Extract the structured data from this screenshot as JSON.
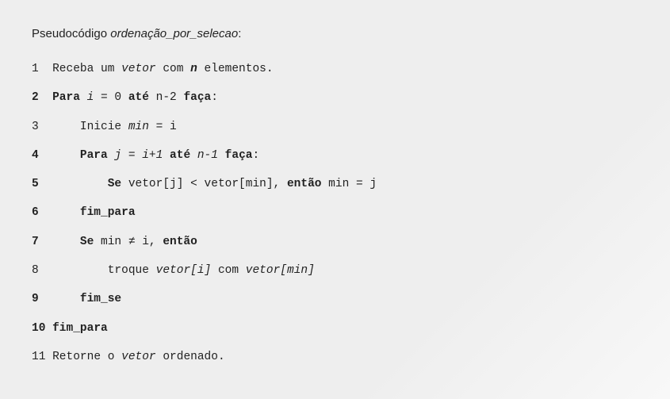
{
  "title": {
    "prefix": "Pseudocódigo ",
    "name": "ordenação_por_selecao",
    "suffix": ":"
  },
  "lines": [
    {
      "num": "1",
      "numBold": false,
      "indent": "",
      "segments": [
        {
          "t": "Receba um ",
          "cls": ""
        },
        {
          "t": "vetor",
          "cls": "i"
        },
        {
          "t": " com ",
          "cls": ""
        },
        {
          "t": "n",
          "cls": "bi"
        },
        {
          "t": " elementos.",
          "cls": ""
        }
      ]
    },
    {
      "num": "2",
      "numBold": true,
      "indent": "",
      "segments": [
        {
          "t": "Para",
          "cls": "b"
        },
        {
          "t": " ",
          "cls": ""
        },
        {
          "t": "i",
          "cls": "i"
        },
        {
          "t": " = 0 ",
          "cls": ""
        },
        {
          "t": "até",
          "cls": "b"
        },
        {
          "t": " n-2 ",
          "cls": ""
        },
        {
          "t": "faça",
          "cls": "b"
        },
        {
          "t": ":",
          "cls": ""
        }
      ]
    },
    {
      "num": "3",
      "numBold": false,
      "indent": "    ",
      "segments": [
        {
          "t": "Inicie ",
          "cls": ""
        },
        {
          "t": "min",
          "cls": "i"
        },
        {
          "t": " = i",
          "cls": ""
        }
      ]
    },
    {
      "num": "4",
      "numBold": true,
      "indent": "    ",
      "segments": [
        {
          "t": "Para",
          "cls": "b"
        },
        {
          "t": " ",
          "cls": ""
        },
        {
          "t": "j",
          "cls": "i"
        },
        {
          "t": " = ",
          "cls": ""
        },
        {
          "t": "i+1",
          "cls": "i"
        },
        {
          "t": " ",
          "cls": ""
        },
        {
          "t": "até",
          "cls": "b"
        },
        {
          "t": " ",
          "cls": ""
        },
        {
          "t": "n-1",
          "cls": "i"
        },
        {
          "t": " ",
          "cls": ""
        },
        {
          "t": "faça",
          "cls": "b"
        },
        {
          "t": ":",
          "cls": ""
        }
      ]
    },
    {
      "num": "5",
      "numBold": true,
      "indent": "        ",
      "segments": [
        {
          "t": "Se",
          "cls": "b"
        },
        {
          "t": " vetor[j] < vetor[min], ",
          "cls": ""
        },
        {
          "t": "então",
          "cls": "b"
        },
        {
          "t": " min = j",
          "cls": ""
        }
      ]
    },
    {
      "num": "6",
      "numBold": true,
      "indent": "    ",
      "segments": [
        {
          "t": "fim_para",
          "cls": "b"
        }
      ]
    },
    {
      "num": "7",
      "numBold": true,
      "indent": "    ",
      "segments": [
        {
          "t": "Se",
          "cls": "b"
        },
        {
          "t": " min ≠ i, ",
          "cls": ""
        },
        {
          "t": "então",
          "cls": "b"
        }
      ]
    },
    {
      "num": "8",
      "numBold": false,
      "indent": "        ",
      "segments": [
        {
          "t": "troque ",
          "cls": ""
        },
        {
          "t": "vetor[i]",
          "cls": "i"
        },
        {
          "t": " com ",
          "cls": ""
        },
        {
          "t": "vetor[min]",
          "cls": "i"
        }
      ]
    },
    {
      "num": "9",
      "numBold": true,
      "indent": "    ",
      "segments": [
        {
          "t": "fim_se",
          "cls": "b"
        }
      ]
    },
    {
      "num": "10",
      "numBold": true,
      "indent": "",
      "segments": [
        {
          "t": "fim_para",
          "cls": "b"
        }
      ]
    },
    {
      "num": "11",
      "numBold": false,
      "indent": "",
      "segments": [
        {
          "t": "Retorne o ",
          "cls": ""
        },
        {
          "t": "vetor",
          "cls": "i"
        },
        {
          "t": " ordenado.",
          "cls": ""
        }
      ]
    }
  ]
}
